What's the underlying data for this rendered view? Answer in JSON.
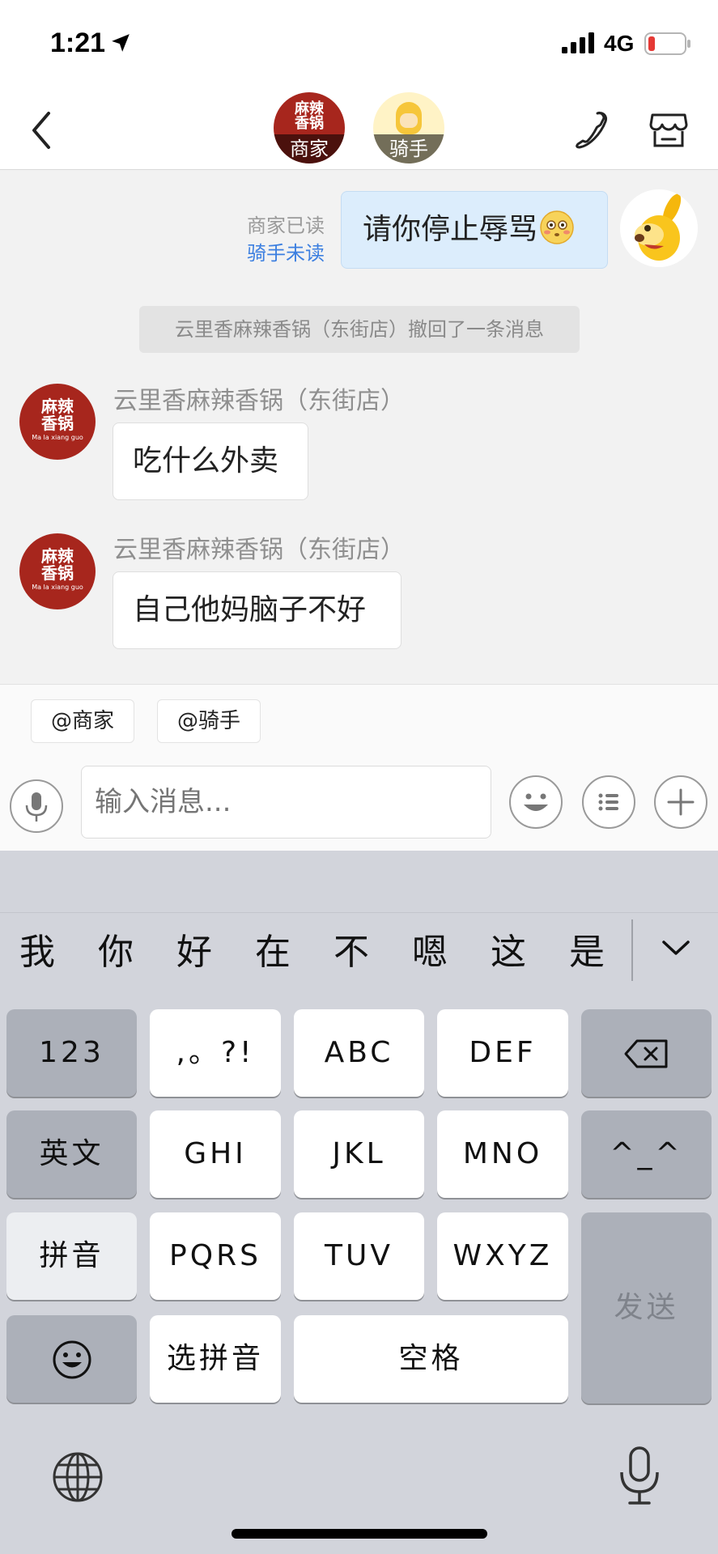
{
  "status_bar": {
    "time": "1:21",
    "network": "4G"
  },
  "nav": {
    "merchant_logo_text": "麻辣\n香锅",
    "merchant_label": "商家",
    "rider_label": "骑手"
  },
  "messages": {
    "outgoing": {
      "text": "请你停止辱骂",
      "read_merchant": "商家已读",
      "read_rider": "骑手未读"
    },
    "recall_notice": "云里香麻辣香锅（东街店）撤回了一条消息",
    "incoming": [
      {
        "sender": "云里香麻辣香锅（东街店）",
        "text": "吃什么外卖",
        "avatar_text": "麻辣\n香锅",
        "avatar_sub": "Ma la xiang guo"
      },
      {
        "sender": "云里香麻辣香锅（东街店）",
        "text": "自己他妈脑子不好",
        "avatar_text": "麻辣\n香锅",
        "avatar_sub": "Ma la xiang guo"
      }
    ]
  },
  "input_panel": {
    "mentions": [
      "@商家",
      "@骑手"
    ],
    "placeholder": "输入消息..."
  },
  "keyboard": {
    "candidates": [
      "我",
      "你",
      "好",
      "在",
      "不",
      "嗯",
      "这",
      "是"
    ],
    "keys": {
      "numbers": "123",
      "punct": ",。?!",
      "abc": "ABC",
      "def": "DEF",
      "english": "英文",
      "ghi": "GHI",
      "jkl": "JKL",
      "mno": "MNO",
      "emoticon": "^_^",
      "pinyin": "拼音",
      "pqrs": "PQRS",
      "tuv": "TUV",
      "wxyz": "WXYZ",
      "send": "发送",
      "select_pinyin": "选拼音",
      "space": "空格"
    }
  },
  "icons": {
    "location": "location-arrow-icon",
    "signal": "signal-icon",
    "battery": "battery-low-icon",
    "back": "back-chevron-icon",
    "phone": "phone-icon",
    "shop": "shop-icon",
    "mic": "microphone-icon",
    "emoji": "emoji-icon",
    "list": "list-icon",
    "plus": "plus-icon",
    "delete": "delete-icon",
    "collapse": "chevron-down-icon",
    "globe": "globe-icon",
    "emoji_key": "smiley-icon"
  },
  "colors": {
    "merchant_red": "#a7261d",
    "outgoing_bubble": "#dcedfc",
    "unread_blue": "#3c7fe0",
    "battery_red": "#e53935"
  }
}
